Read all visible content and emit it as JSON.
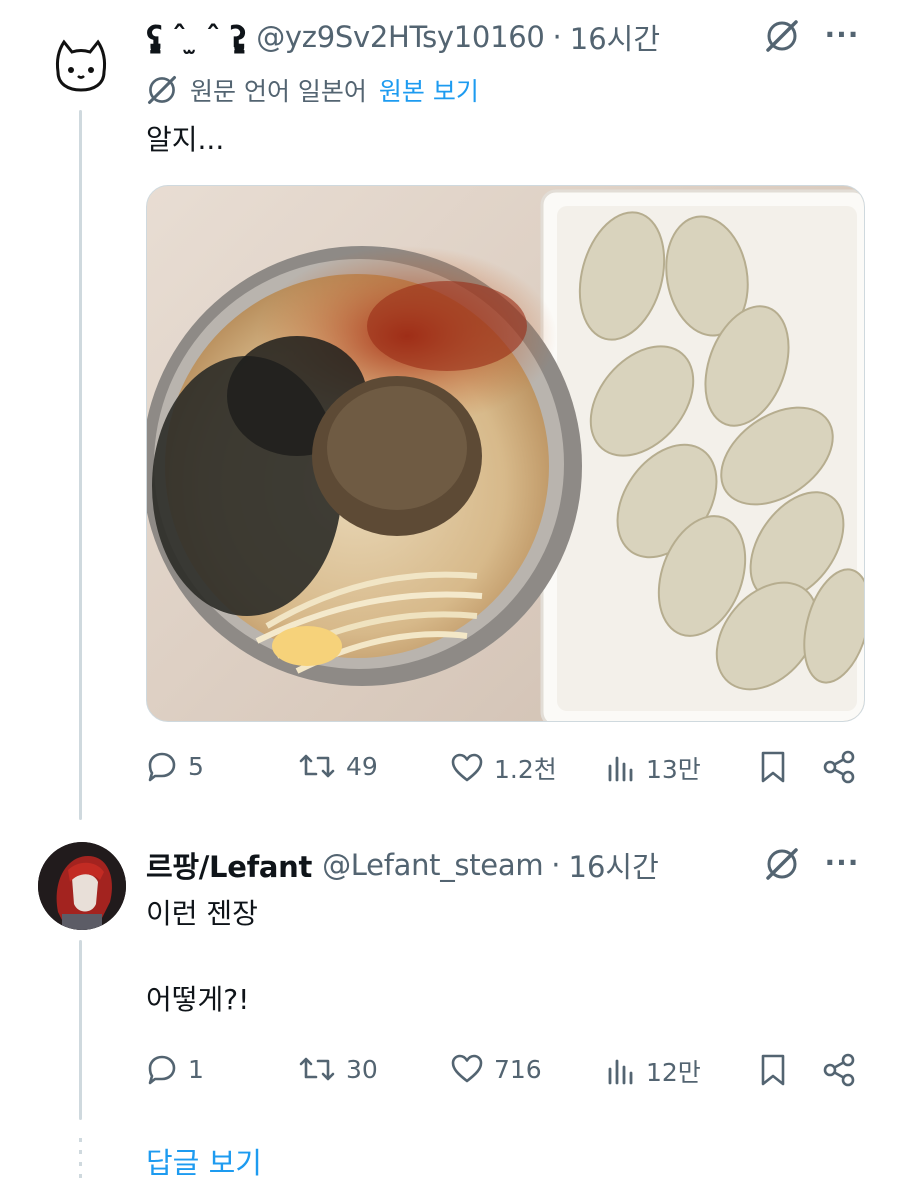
{
  "tweets": [
    {
      "avatar": "cat-doodle",
      "display_name": "ʕ̡̢̡ ˆ ̫ ˆ ʔ̢̡̢",
      "handle": "@yz9Sv2HTsy10160",
      "separator": "·",
      "time": "16시간",
      "translation": {
        "note": "원문 언어 일본어",
        "show_original": "원본 보기"
      },
      "text": "알지...",
      "image_alt": "photo: noodle soup bowl topped with seasoning and a plate of dumplings",
      "stats": {
        "replies": "5",
        "retweets": "49",
        "likes": "1.2천",
        "views": "13만"
      }
    },
    {
      "avatar": "red-hair-character",
      "display_name": "르팡/Lefant",
      "handle": "@Lefant_steam",
      "separator": "·",
      "time": "16시간",
      "text": "이런 젠장\n\n어떻게?!",
      "stats": {
        "replies": "1",
        "retweets": "30",
        "likes": "716",
        "views": "12만"
      }
    }
  ],
  "more_replies_label": "답글 보기",
  "colors": {
    "text": "#0f1419",
    "muted": "#536471",
    "link": "#1d9bf0",
    "thread": "#cfd9de"
  },
  "icons": [
    "grok-icon",
    "more-icon",
    "reply-icon",
    "retweet-icon",
    "like-icon",
    "views-icon",
    "bookmark-icon",
    "share-icon"
  ]
}
